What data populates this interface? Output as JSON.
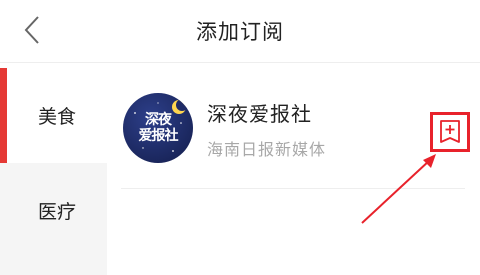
{
  "header": {
    "title": "添加订阅",
    "back_icon": "chevron-left-icon"
  },
  "sidebar": {
    "items": [
      {
        "label": "美食",
        "active": true
      },
      {
        "label": "医疗",
        "active": false
      }
    ],
    "accent_color": "#e53935"
  },
  "subscriptions": [
    {
      "name": "深夜爱报社",
      "source": "海南日报新媒体",
      "avatar_text": [
        "深夜",
        "爱报社"
      ],
      "action_icon": "add-bookmark-icon"
    }
  ],
  "annotation": {
    "highlight_color": "#e8222b",
    "arrow_icon": "pointer-arrow-icon"
  }
}
